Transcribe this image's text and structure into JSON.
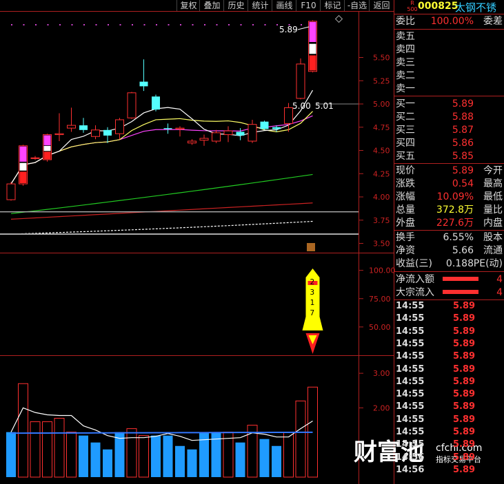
{
  "toolbar": {
    "buttons": [
      "复权",
      "叠加",
      "历史",
      "统计",
      "画线",
      "F10",
      "标记",
      "-自选",
      "返回"
    ]
  },
  "stock": {
    "badge_top": "R",
    "badge_bottom": "500",
    "code": "000825",
    "name": "太钢不锈"
  },
  "order_book": {
    "weibi_label": "委比",
    "weibi_value": "100.00%",
    "weicha_label": "委差",
    "asks": [
      "卖五",
      "卖四",
      "卖三",
      "卖二",
      "卖一"
    ],
    "bids": [
      {
        "label": "买一",
        "price": "5.89"
      },
      {
        "label": "买二",
        "price": "5.88"
      },
      {
        "label": "买三",
        "price": "5.87"
      },
      {
        "label": "买四",
        "price": "5.86"
      },
      {
        "label": "买五",
        "price": "5.85"
      }
    ]
  },
  "quote": [
    {
      "label": "现价",
      "value": "5.89",
      "right": "今开"
    },
    {
      "label": "涨跌",
      "value": "0.54",
      "right": "最高"
    },
    {
      "label": "涨幅",
      "value": "10.09%",
      "right": "最低"
    },
    {
      "label": "总量",
      "value": "372.8万",
      "right": "量比"
    },
    {
      "label": "外盘",
      "value": "227.6万",
      "right": "内盘"
    }
  ],
  "stats": [
    {
      "label": "换手",
      "value": "6.55%",
      "right": "股本"
    },
    {
      "label": "净资",
      "value": "5.66",
      "right": "流通"
    },
    {
      "label": "收益(三)",
      "value": "0.188",
      "right": "PE(动)"
    }
  ],
  "flows": [
    {
      "label": "净流入额",
      "value": "4"
    },
    {
      "label": "大宗流入",
      "value": "4"
    }
  ],
  "ticks": [
    {
      "time": "14:55",
      "price": "5.89"
    },
    {
      "time": "14:55",
      "price": "5.89"
    },
    {
      "time": "14:55",
      "price": "5.89"
    },
    {
      "time": "14:55",
      "price": "5.89"
    },
    {
      "time": "14:55",
      "price": "5.89"
    },
    {
      "time": "14:55",
      "price": "5.89"
    },
    {
      "time": "14:55",
      "price": "5.89"
    },
    {
      "time": "14:55",
      "price": "5.89"
    },
    {
      "time": "14:55",
      "price": "5.89"
    },
    {
      "time": "14:55",
      "price": "5.89"
    },
    {
      "time": "14:55",
      "price": "5.89"
    },
    {
      "time": "14:55",
      "price": "5.89"
    },
    {
      "time": "14:56",
      "price": "5.89"
    },
    {
      "time": "14:56",
      "price": "5.89"
    }
  ],
  "watermark": {
    "brand": "财富池",
    "site": "cfchi.com",
    "tagline": "指标交易平台"
  },
  "colors": {
    "up": "#ff3030",
    "down": "#54ffff",
    "ma5": "#ffffff",
    "ma10": "#ffff66",
    "ma20": "#ff44ff",
    "ma60": "#22cc22",
    "ma120": "#cc2222",
    "ma250": "#ffffff"
  },
  "chart_data": [
    {
      "type": "candlestick",
      "ylim": [
        3.4,
        6.0
      ],
      "yticks": [
        5.5,
        5.25,
        5.0,
        4.75,
        4.5,
        4.25,
        4.0,
        3.75,
        3.5
      ],
      "annotations": [
        "5.89",
        "5.00",
        "5.01"
      ],
      "candles": [
        {
          "o": 3.97,
          "c": 4.14,
          "h": 4.16,
          "l": 3.96
        },
        {
          "o": 4.14,
          "c": 4.55,
          "h": 4.56,
          "l": 4.12
        },
        {
          "o": 4.42,
          "c": 4.42,
          "h": 4.44,
          "l": 4.4
        },
        {
          "o": 4.4,
          "c": 4.67,
          "h": 4.68,
          "l": 4.38
        },
        {
          "o": 4.67,
          "c": 4.68,
          "h": 4.9,
          "l": 4.6
        },
        {
          "o": 4.74,
          "c": 4.77,
          "h": 4.96,
          "l": 4.7
        },
        {
          "o": 4.77,
          "c": 4.72,
          "h": 4.85,
          "l": 4.69
        },
        {
          "o": 4.65,
          "c": 4.72,
          "h": 4.77,
          "l": 4.62
        },
        {
          "o": 4.72,
          "c": 4.66,
          "h": 4.75,
          "l": 4.58
        },
        {
          "o": 4.68,
          "c": 4.83,
          "h": 4.85,
          "l": 4.62
        },
        {
          "o": 4.85,
          "c": 5.12,
          "h": 5.13,
          "l": 4.84
        },
        {
          "o": 5.24,
          "c": 5.19,
          "h": 5.48,
          "l": 5.14
        },
        {
          "o": 5.08,
          "c": 4.94,
          "h": 5.1,
          "l": 4.92
        },
        {
          "o": 4.74,
          "c": 4.73,
          "h": 4.79,
          "l": 4.68
        },
        {
          "o": 4.73,
          "c": 4.74,
          "h": 4.76,
          "l": 4.65
        },
        {
          "o": 4.58,
          "c": 4.6,
          "h": 4.62,
          "l": 4.56
        },
        {
          "o": 4.61,
          "c": 4.63,
          "h": 4.67,
          "l": 4.55
        },
        {
          "o": 4.6,
          "c": 4.69,
          "h": 4.72,
          "l": 4.58
        },
        {
          "o": 4.67,
          "c": 4.71,
          "h": 4.76,
          "l": 4.59
        },
        {
          "o": 4.7,
          "c": 4.66,
          "h": 4.74,
          "l": 4.61
        },
        {
          "o": 4.6,
          "c": 4.78,
          "h": 4.83,
          "l": 4.58
        },
        {
          "o": 4.81,
          "c": 4.73,
          "h": 4.82,
          "l": 4.72
        },
        {
          "o": 4.75,
          "c": 4.73,
          "h": 4.77,
          "l": 4.7
        },
        {
          "o": 4.79,
          "c": 4.96,
          "h": 5.01,
          "l": 4.7
        },
        {
          "o": 5.06,
          "c": 5.43,
          "h": 5.49,
          "l": 5.05
        },
        {
          "o": 5.35,
          "c": 5.89,
          "h": 5.9,
          "l": 5.34
        }
      ]
    },
    {
      "type": "volume_bar",
      "yticks": [
        3.0,
        2.0
      ],
      "ylim": [
        0,
        3.5
      ],
      "series": [
        {
          "name": "down",
          "values": [
            1.3,
            0,
            0,
            0,
            0,
            0,
            1.2,
            1.0,
            0.8,
            1.3,
            0,
            0,
            1.2,
            1.2,
            0.9,
            0.8,
            1.3,
            1.3,
            0,
            1.0,
            0,
            1.1,
            0.9,
            0,
            0,
            0
          ]
        },
        {
          "name": "up",
          "values": [
            0,
            2.7,
            1.6,
            1.6,
            1.7,
            1.3,
            0,
            0,
            0,
            0,
            1.4,
            1.2,
            0,
            0,
            0,
            0,
            0,
            0,
            1.3,
            0,
            1.5,
            0,
            0,
            1.3,
            2.2,
            2.6
          ]
        }
      ]
    },
    {
      "type": "indicator",
      "yticks": [
        100.0,
        75.0,
        50.0
      ],
      "ylim": [
        25,
        115
      ],
      "signal_digits": [
        "2",
        "3",
        "1",
        "7"
      ]
    }
  ]
}
